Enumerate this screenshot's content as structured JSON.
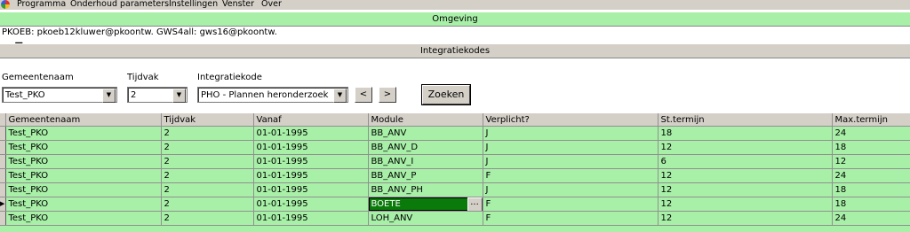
{
  "menu": {
    "items": [
      "Programma",
      "Onderhoud parameters",
      "Instellingen",
      "Venster",
      "Over"
    ]
  },
  "omgeving": {
    "title": "Omgeving",
    "connection": "PKOEB: pkoeb12kluwer@pkoontw. GWS4all: gws16@pkoontw."
  },
  "integratie": {
    "title": "Integratiekodes"
  },
  "filters": {
    "gemeente_label": "Gemeentenaam",
    "gemeente_value": "Test_PKO",
    "tijdvak_label": "Tijdvak",
    "tijdvak_value": "2",
    "integratiekode_label": "Integratiekode",
    "integratiekode_value": "PHO - Plannen heronderzoek",
    "prev_label": "<",
    "next_label": ">",
    "search_label": "Zoeken"
  },
  "grid": {
    "columns": [
      "Gemeentenaam",
      "Tijdvak",
      "Vanaf",
      "Module",
      "Verplicht?",
      "St.termijn",
      "Max.termijn"
    ],
    "rows": [
      [
        "Test_PKO",
        "2",
        "01-01-1995",
        "BB_ANV",
        "J",
        "18",
        "24"
      ],
      [
        "Test_PKO",
        "2",
        "01-01-1995",
        "BB_ANV_D",
        "J",
        "12",
        "18"
      ],
      [
        "Test_PKO",
        "2",
        "01-01-1995",
        "BB_ANV_I",
        "J",
        "6",
        "12"
      ],
      [
        "Test_PKO",
        "2",
        "01-01-1995",
        "BB_ANV_P",
        "F",
        "12",
        "24"
      ],
      [
        "Test_PKO",
        "2",
        "01-01-1995",
        "BB_ANV_PH",
        "J",
        "12",
        "18"
      ],
      [
        "Test_PKO",
        "2",
        "01-01-1995",
        "BOETE",
        "F",
        "12",
        "18"
      ],
      [
        "Test_PKO",
        "2",
        "01-01-1995",
        "LOH_ANV",
        "F",
        "12",
        "24"
      ]
    ],
    "current_row": 5,
    "selected_cell_button": "..."
  },
  "colors": {
    "green_band": "#a8f0a8",
    "selected_cell": "#0a7a0a",
    "window_gray": "#d4d0c8"
  }
}
